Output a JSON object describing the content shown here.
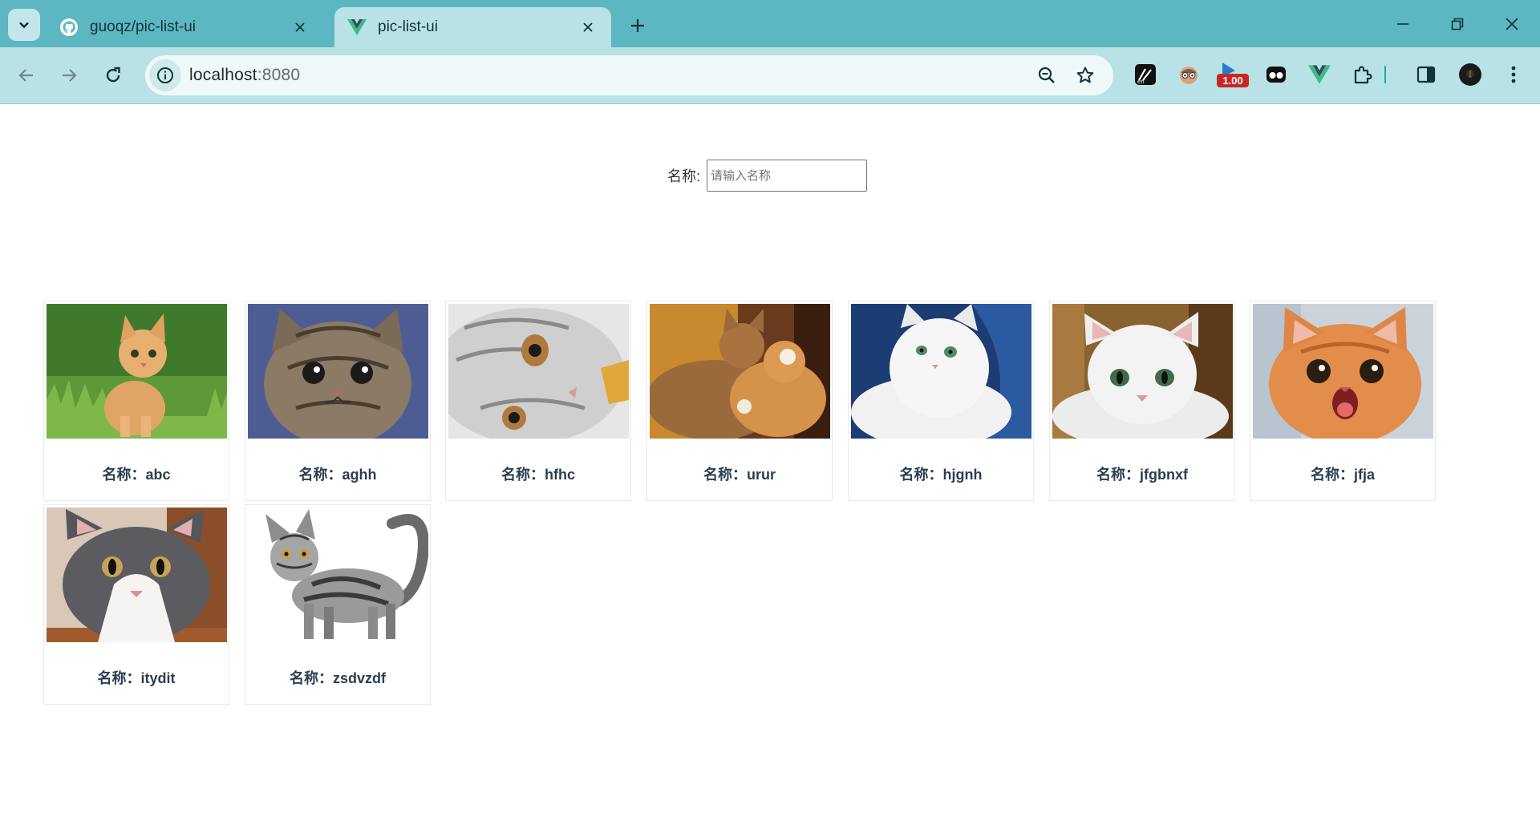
{
  "browser": {
    "tabs": [
      {
        "title": "guoqz/pic-list-ui",
        "favicon": "github-icon",
        "active": false
      },
      {
        "title": "pic-list-ui",
        "favicon": "vue-icon",
        "active": true
      }
    ],
    "url_host": "localhost",
    "url_port": ":8080",
    "extension_badge": "1.00",
    "accent": "#5cb7c2"
  },
  "filter": {
    "label": "名称:",
    "placeholder": "请输入名称",
    "value": ""
  },
  "cards": [
    {
      "caption": "名称：abc",
      "image": "orange kitten on grass"
    },
    {
      "caption": "名称：aghh",
      "image": "tabby kitten face"
    },
    {
      "caption": "名称：hfhc",
      "image": "white silver cat lying"
    },
    {
      "caption": "名称：urur",
      "image": "two orange cats in sunlight"
    },
    {
      "caption": "名称：hjgnh",
      "image": "white persian cat on blue"
    },
    {
      "caption": "名称：jfgbnxf",
      "image": "white cat with green eyes"
    },
    {
      "caption": "名称：jfja",
      "image": "orange kitten meowing"
    },
    {
      "caption": "名称：itydit",
      "image": "grey and white kitten"
    },
    {
      "caption": "名称：zsdvzdf",
      "image": "silver tabby kitten standing"
    }
  ]
}
